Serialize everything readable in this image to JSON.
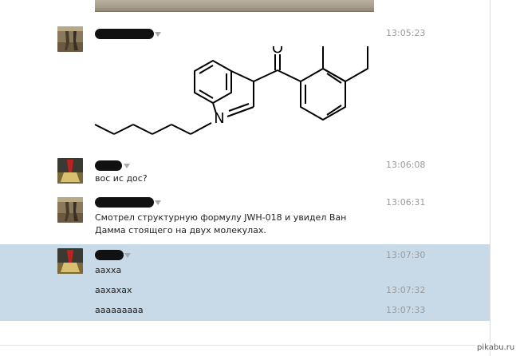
{
  "messages": [
    {
      "time": "13:05:23",
      "text": ""
    },
    {
      "time": "13:06:08",
      "text": "вос ис дос?"
    },
    {
      "time": "13:06:31",
      "text": "Смотрел структурную формулу JWH-018 и увидел Ван Дамма стоящего на двух молекулах."
    },
    {
      "time": "13:07:30",
      "text": "аахха"
    }
  ],
  "continuations": [
    {
      "time": "13:07:32",
      "text": "аахахах"
    },
    {
      "time": "13:07:33",
      "text": "ааааааааа"
    }
  ],
  "molecule": {
    "atom_n": "N",
    "atom_o": "O"
  },
  "watermark": "pikabu.ru",
  "colors": {
    "highlight": "#c8dae8",
    "time": "#9a9a9a"
  }
}
